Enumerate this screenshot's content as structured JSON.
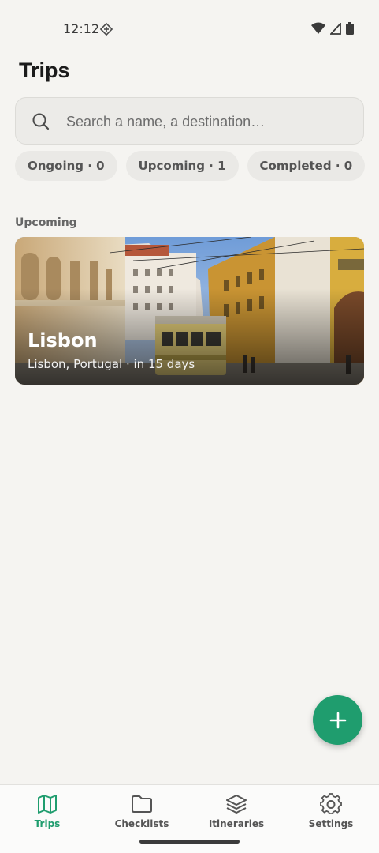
{
  "status_bar": {
    "time": "12:12"
  },
  "header": {
    "title": "Trips"
  },
  "search": {
    "placeholder": "Search a name, a destination…"
  },
  "filters": [
    {
      "label": "Ongoing · 0"
    },
    {
      "label": "Upcoming · 1"
    },
    {
      "label": "Completed · 0"
    }
  ],
  "sections": [
    {
      "label": "Upcoming",
      "trips": [
        {
          "title": "Lisbon",
          "subtitle": "Lisbon, Portugal · in 15 days"
        }
      ]
    }
  ],
  "fab": {
    "icon": "plus-icon"
  },
  "bottom_nav": {
    "active": "Trips",
    "accent_color": "#1f9d6e",
    "items": [
      {
        "label": "Trips",
        "icon": "map-icon"
      },
      {
        "label": "Checklists",
        "icon": "folder-icon"
      },
      {
        "label": "Itineraries",
        "icon": "layers-icon"
      },
      {
        "label": "Settings",
        "icon": "gear-icon"
      }
    ]
  }
}
